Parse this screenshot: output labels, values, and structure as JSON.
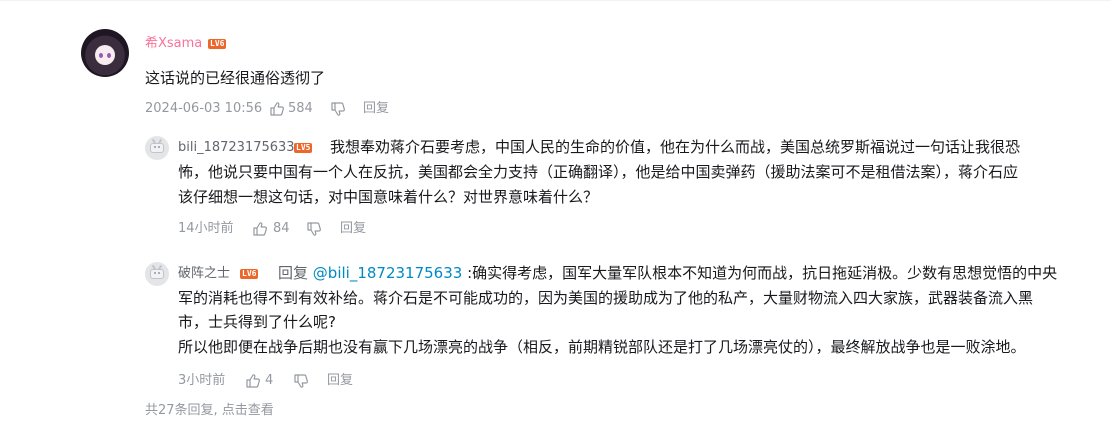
{
  "main_comment": {
    "username": "希Xsama",
    "level": "LV6",
    "text": "这话说的已经很通俗透彻了",
    "time": "2024-06-03 10:56",
    "likes": "584",
    "reply_label": "回复",
    "avatar_icon": "anime-girl-avatar"
  },
  "replies": [
    {
      "username": "bili_18723175633",
      "level": "LV5",
      "lines": [
        "我想奉劝蒋介石要考虑，中国人民的生命的价值，他在为什么而战，美国总统罗斯福说过一句话让我很恐",
        "怖，他说只要中国有一个人在反抗，美国都会全力支持（正确翻译），他是给中国卖弹药（援助法案可不是租借法案），蒋介石应",
        "该仔细想一想这句话，对中国意味着什么？对世界意味着什么？"
      ],
      "time": "14小时前",
      "likes": "84",
      "reply_label": "回复"
    },
    {
      "username": "破阵之士",
      "level": "LV6",
      "reply_prefix": "回复",
      "mention": "@bili_18723175633",
      "lines": [
        " :确实得考虑，国军大量军队根本不知道为何而战，抗日拖延消极。少数有思想觉悟的中央",
        "军的消耗也得不到有效补给。蒋介石是不可能成功的，因为美国的援助成为了他的私产，大量财物流入四大家族，武器装备流入黑",
        "市，士兵得到了什么呢?",
        "所以他即便在战争后期也没有赢下几场漂亮的战争（相反，前期精锐部队还是打了几场漂亮仗的），最终解放战争也是一败涂地。"
      ],
      "time": "3小时前",
      "likes": "4",
      "reply_label": "回复"
    }
  ],
  "footer": {
    "view_more": "共27条回复, 点击查看"
  },
  "colors": {
    "pink_username": "#fb7299",
    "level_badge": "#ee672a",
    "mention": "#008ac5",
    "meta_gray": "#9499a0"
  }
}
